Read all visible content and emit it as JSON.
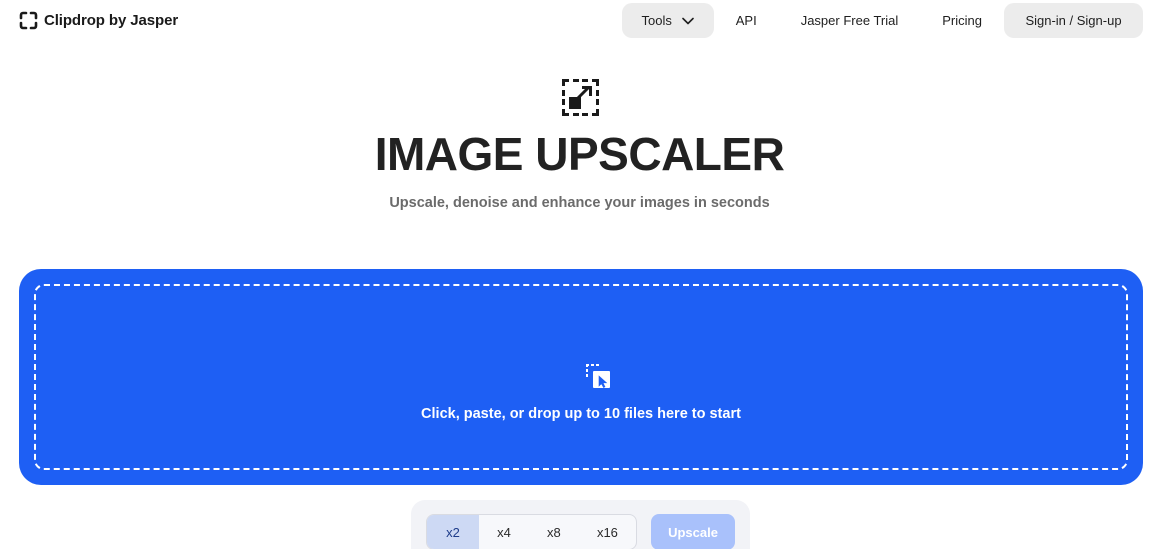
{
  "header": {
    "logo_text": "Clipdrop by Jasper",
    "nav": {
      "tools_label": "Tools",
      "api_label": "API",
      "trial_label": "Jasper Free Trial",
      "pricing_label": "Pricing",
      "signin_label": "Sign-in / Sign-up"
    }
  },
  "hero": {
    "icon": "expand-arrow-icon",
    "title": "IMAGE UPSCALER",
    "subtitle": "Upscale, denoise and enhance your images in seconds"
  },
  "dropzone": {
    "icon": "drop-cursor-icon",
    "text": "Click, paste, or drop up to 10 files here to start"
  },
  "controls": {
    "scales": [
      "x2",
      "x4",
      "x8",
      "x16"
    ],
    "selected_scale": "x2",
    "upscale_label": "Upscale"
  },
  "colors": {
    "accent": "#1e5ff4",
    "pill_bg": "#ececec",
    "selected_scale_bg": "#cdd9f4",
    "upscale_disabled": "#a9c1fb"
  }
}
